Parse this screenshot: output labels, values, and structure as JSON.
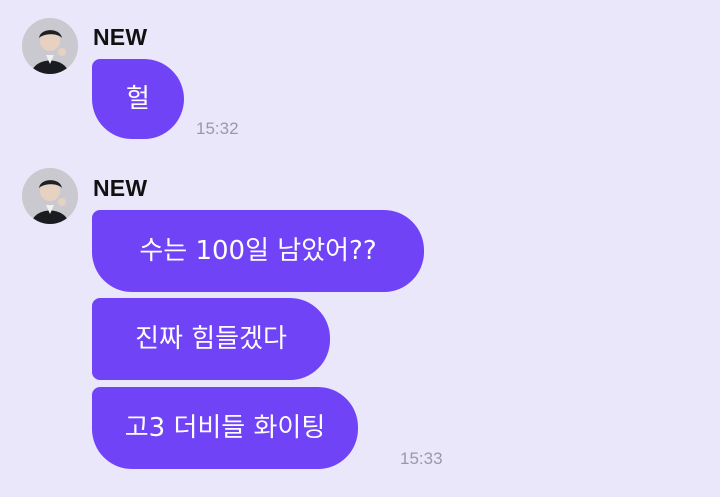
{
  "chat": {
    "groups": [
      {
        "sender": "NEW",
        "avatar_icon": "profile-photo",
        "messages": [
          "헐"
        ],
        "time": "15:32"
      },
      {
        "sender": "NEW",
        "avatar_icon": "profile-photo",
        "messages": [
          "수는 100일 남았어??",
          "진짜 힘들겠다",
          "고3 더비들 화이팅"
        ],
        "time": "15:33"
      }
    ]
  },
  "colors": {
    "background": "#ebe7fb",
    "bubble": "#7043f7",
    "bubble_text": "#ffffff",
    "sender_text": "#111111",
    "time_text": "#9b98a6"
  }
}
